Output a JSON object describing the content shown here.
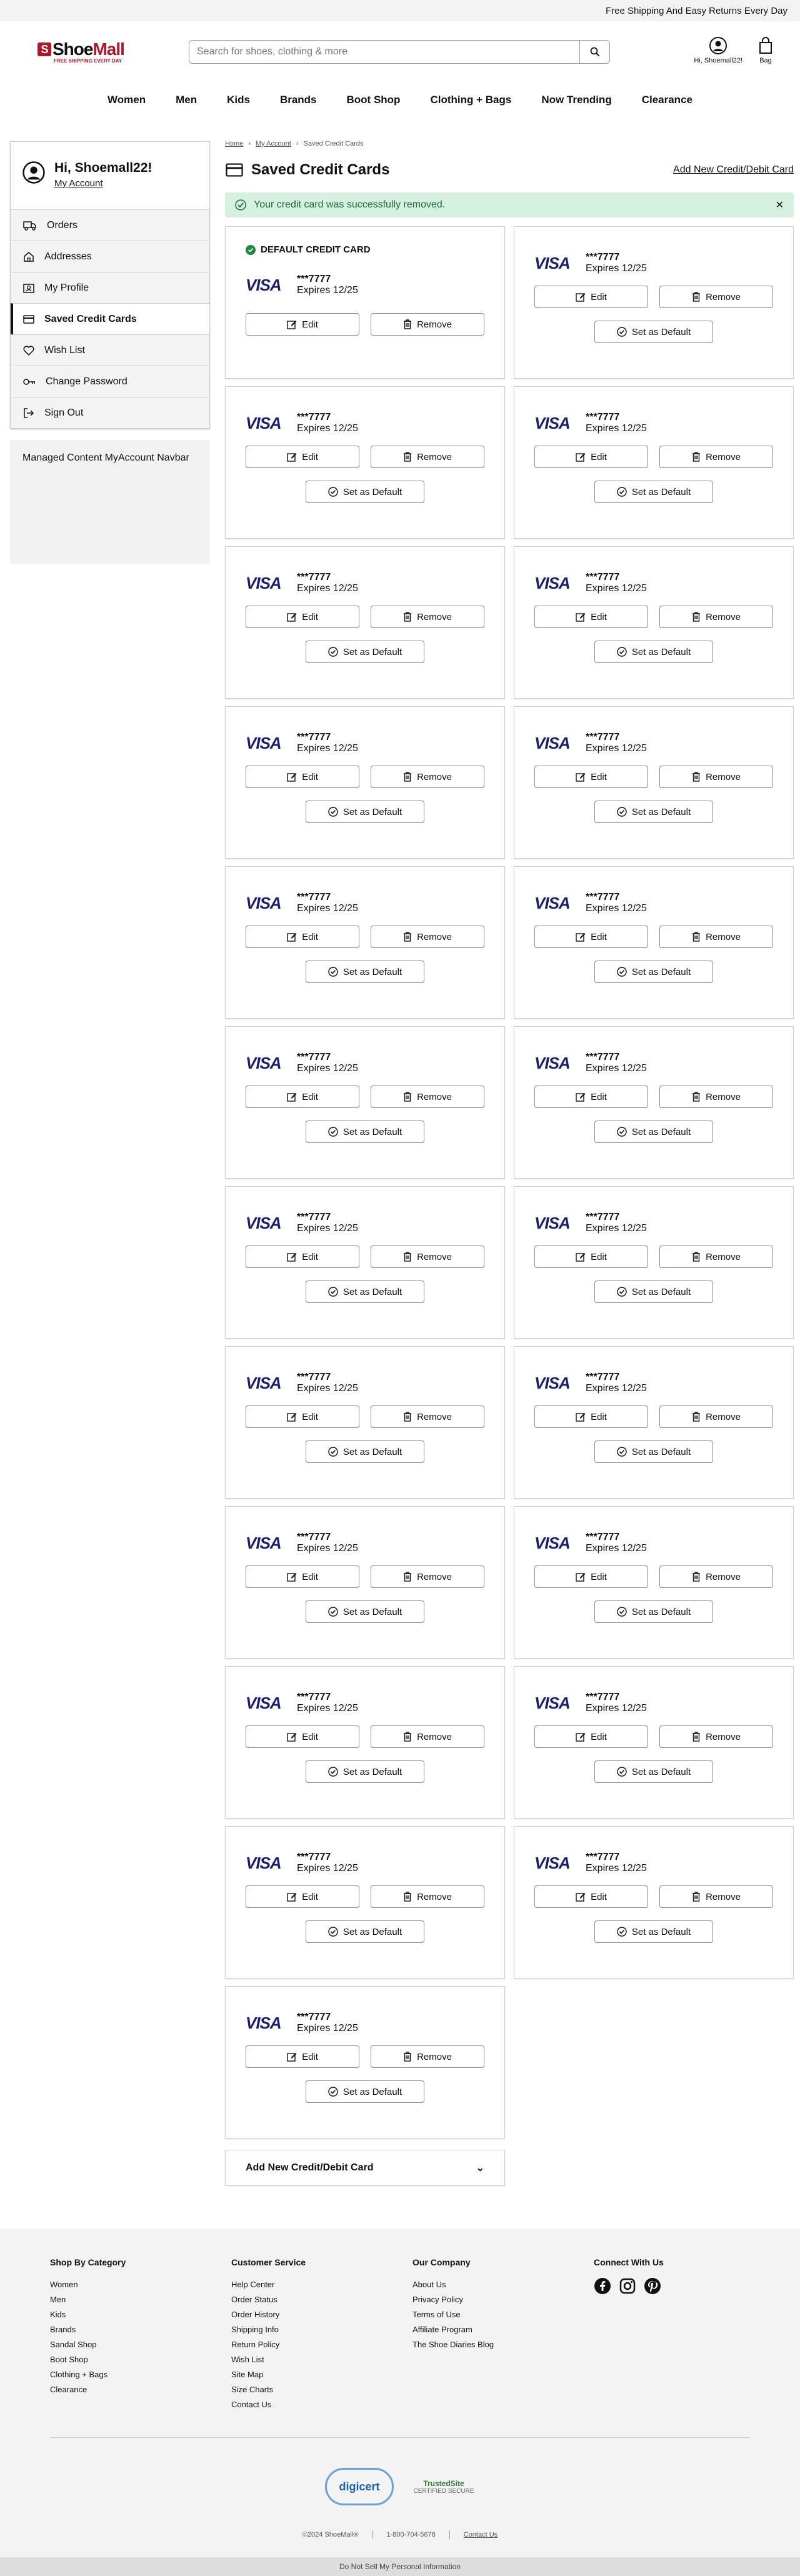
{
  "topbar": {
    "message": "Free Shipping And Easy Returns Every Day"
  },
  "logo": {
    "shoe": "Shoe",
    "mall": "Mall",
    "tagline": "FREE SHIPPING EVERY DAY"
  },
  "search": {
    "placeholder": "Search for shoes, clothing & more"
  },
  "header": {
    "account_label": "Hi, Shoemall22!",
    "bag_label": "Bag"
  },
  "nav": [
    "Women",
    "Men",
    "Kids",
    "Brands",
    "Boot Shop",
    "Clothing + Bags",
    "Now Trending",
    "Clearance"
  ],
  "sidebar": {
    "greeting": "Hi, Shoemall22!",
    "my_account": "My Account",
    "items": [
      {
        "label": "Orders",
        "icon": "truck-icon"
      },
      {
        "label": "Addresses",
        "icon": "home-icon"
      },
      {
        "label": "My Profile",
        "icon": "profile-icon"
      },
      {
        "label": "Saved Credit Cards",
        "icon": "credit-card-icon",
        "active": true
      },
      {
        "label": "Wish List",
        "icon": "heart-icon"
      },
      {
        "label": "Change Password",
        "icon": "key-icon"
      },
      {
        "label": "Sign Out",
        "icon": "sign-out-icon"
      }
    ],
    "managed": "Managed Content MyAccount Navbar"
  },
  "breadcrumb": {
    "home": "Home",
    "account": "My Account",
    "current": "Saved Credit Cards"
  },
  "page": {
    "title": "Saved Credit Cards",
    "add_link": "Add New Credit/Debit Card",
    "alert": "Your credit card was successfully removed.",
    "default_label": "DEFAULT CREDIT CARD",
    "edit_label": "Edit",
    "remove_label": "Remove",
    "set_default_label": "Set as Default",
    "accordion_label": "Add New Credit/Debit Card"
  },
  "cards": [
    {
      "brand": "VISA",
      "number": "***7777",
      "expires": "Expires 12/25",
      "default": true
    },
    {
      "brand": "VISA",
      "number": "***7777",
      "expires": "Expires 12/25"
    },
    {
      "brand": "VISA",
      "number": "***7777",
      "expires": "Expires 12/25"
    },
    {
      "brand": "VISA",
      "number": "***7777",
      "expires": "Expires 12/25"
    },
    {
      "brand": "VISA",
      "number": "***7777",
      "expires": "Expires 12/25"
    },
    {
      "brand": "VISA",
      "number": "***7777",
      "expires": "Expires 12/25"
    },
    {
      "brand": "VISA",
      "number": "***7777",
      "expires": "Expires 12/25"
    },
    {
      "brand": "VISA",
      "number": "***7777",
      "expires": "Expires 12/25"
    },
    {
      "brand": "VISA",
      "number": "***7777",
      "expires": "Expires 12/25"
    },
    {
      "brand": "VISA",
      "number": "***7777",
      "expires": "Expires 12/25"
    },
    {
      "brand": "VISA",
      "number": "***7777",
      "expires": "Expires 12/25"
    },
    {
      "brand": "VISA",
      "number": "***7777",
      "expires": "Expires 12/25"
    },
    {
      "brand": "VISA",
      "number": "***7777",
      "expires": "Expires 12/25"
    },
    {
      "brand": "VISA",
      "number": "***7777",
      "expires": "Expires 12/25"
    },
    {
      "brand": "VISA",
      "number": "***7777",
      "expires": "Expires 12/25"
    },
    {
      "brand": "VISA",
      "number": "***7777",
      "expires": "Expires 12/25"
    },
    {
      "brand": "VISA",
      "number": "***7777",
      "expires": "Expires 12/25"
    },
    {
      "brand": "VISA",
      "number": "***7777",
      "expires": "Expires 12/25"
    },
    {
      "brand": "VISA",
      "number": "***7777",
      "expires": "Expires 12/25"
    },
    {
      "brand": "VISA",
      "number": "***7777",
      "expires": "Expires 12/25"
    },
    {
      "brand": "VISA",
      "number": "***7777",
      "expires": "Expires 12/25"
    },
    {
      "brand": "VISA",
      "number": "***7777",
      "expires": "Expires 12/25"
    },
    {
      "brand": "VISA",
      "number": "***7777",
      "expires": "Expires 12/25"
    }
  ],
  "footer": {
    "shop": {
      "title": "Shop By Category",
      "links": [
        "Women",
        "Men",
        "Kids",
        "Brands",
        "Sandal Shop",
        "Boot Shop",
        "Clothing + Bags",
        "Clearance"
      ]
    },
    "service": {
      "title": "Customer Service",
      "links": [
        "Help Center",
        "Order Status",
        "Order History",
        "Shipping Info",
        "Return Policy",
        "Wish List",
        "Site Map",
        "Size Charts",
        "Contact Us"
      ]
    },
    "company": {
      "title": "Our Company",
      "links": [
        "About Us",
        "Privacy Policy",
        "Terms of Use",
        "Affiliate Program",
        "The Shoe Diaries Blog"
      ]
    },
    "connect": {
      "title": "Connect With Us"
    },
    "digicert": "digicert",
    "trustedsite": "TrustedSite",
    "trustedsite_sub": "CERTIFIED SECURE",
    "copyright": "©2024 ShoeMall®",
    "phone": "1-800-704-5678",
    "contact": "Contact Us",
    "dns": "Do Not Sell My Personal Information"
  }
}
